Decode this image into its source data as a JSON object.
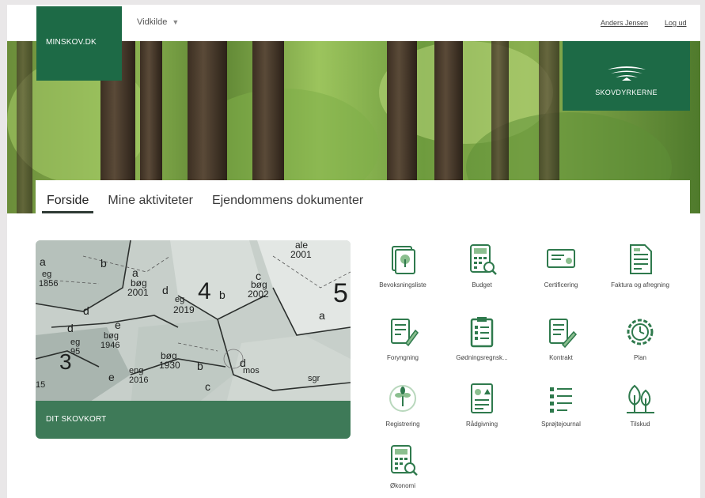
{
  "header": {
    "logo_text": "MINSKOV.DK",
    "dropdown_label": "Vidkilde",
    "user_name": "Anders Jensen",
    "logout": "Log ud",
    "brand_text": "SKOVDYRKERNE"
  },
  "tabs": [
    {
      "label": "Forside",
      "active": true
    },
    {
      "label": "Mine aktiviteter",
      "active": false
    },
    {
      "label": "Ejendommens dokumenter",
      "active": false
    }
  ],
  "map_card": {
    "footer_label": "DIT SKOVKORT",
    "labels": [
      "a",
      "b",
      "eg",
      "1856",
      "a",
      "bøg",
      "2001",
      "4",
      "d",
      "eg",
      "2019",
      "b",
      "c",
      "bøg",
      "2002",
      "5",
      "ale",
      "2001",
      "d",
      "a",
      "d",
      "e",
      "bøg",
      "1946",
      "eg",
      "95",
      "3",
      "bøg",
      "1930",
      "eng",
      "2016",
      "b",
      "c",
      "d",
      "mos",
      "sgr",
      "15",
      "e"
    ]
  },
  "tiles": [
    {
      "label": "Bevoksningsliste",
      "icon": "tree-document-icon"
    },
    {
      "label": "Budget",
      "icon": "calculator-search-icon"
    },
    {
      "label": "Certificering",
      "icon": "certificate-icon"
    },
    {
      "label": "Faktura og afregning",
      "icon": "invoice-icon"
    },
    {
      "label": "Foryngning",
      "icon": "document-pen-icon"
    },
    {
      "label": "Gødningsregnsk...",
      "icon": "clipboard-checklist-icon"
    },
    {
      "label": "Kontrakt",
      "icon": "contract-pen-icon"
    },
    {
      "label": "Plan",
      "icon": "gear-clock-icon"
    },
    {
      "label": "Registrering",
      "icon": "seedling-icon"
    },
    {
      "label": "Rådgivning",
      "icon": "chart-document-icon"
    },
    {
      "label": "Sprøjtejournal",
      "icon": "checklist-icon"
    },
    {
      "label": "Tilskud",
      "icon": "trees-icon"
    },
    {
      "label": "Økonomi",
      "icon": "calculator-search-icon"
    }
  ],
  "colors": {
    "brand_green": "#1d6a46",
    "map_footer": "#3e7a58",
    "icon_green": "#2f7a4d"
  }
}
